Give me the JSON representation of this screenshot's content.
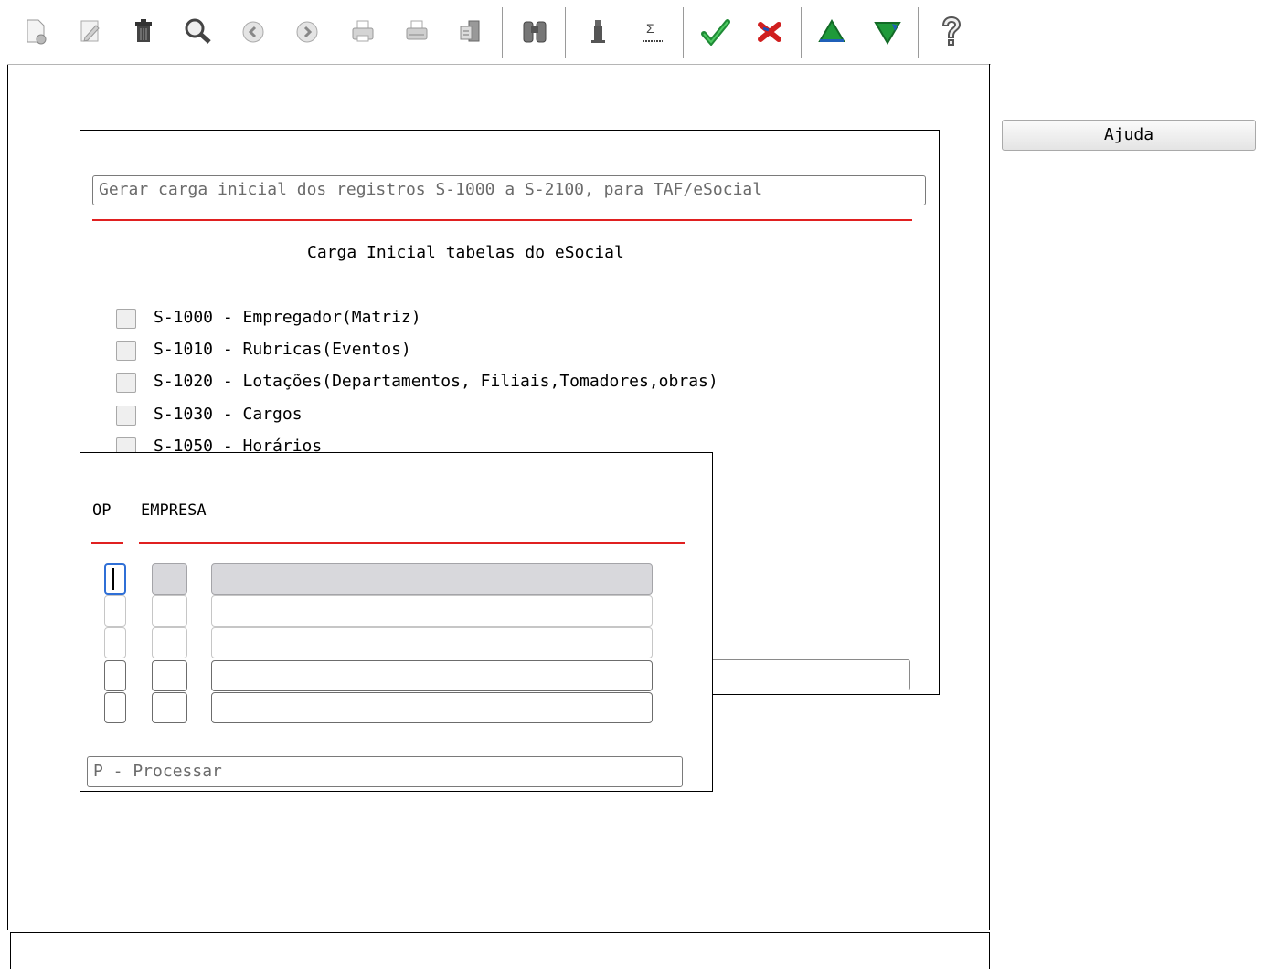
{
  "toolbar": {
    "icons": [
      "new-document-icon",
      "edit-icon",
      "delete-icon",
      "search-icon",
      "previous-icon",
      "next-icon",
      "print-icon",
      "print-setup-icon",
      "export-icon",
      "binoculars-icon",
      "info-icon",
      "sum-icon",
      "confirm-check-icon",
      "cancel-icon",
      "move-up-icon",
      "move-down-icon",
      "help-icon"
    ]
  },
  "side": {
    "help_label": "Ajuda"
  },
  "main_dialog": {
    "description": "Gerar carga inicial dos registros S-1000 a S-2100, para TAF/eSocial",
    "section_title": "Carga Inicial tabelas do eSocial",
    "items": [
      {
        "label": "S-1000 - Empregador(Matriz)",
        "checked": false
      },
      {
        "label": "S-1010 - Rubricas(Eventos)",
        "checked": false
      },
      {
        "label": "S-1020 - Lotações(Departamentos, Filiais,Tomadores,obras)",
        "checked": false
      },
      {
        "label": "S-1030 - Cargos",
        "checked": false
      },
      {
        "label": "S-1050 - Horários",
        "checked": false
      }
    ]
  },
  "company_dialog": {
    "col_op": "OP",
    "col_empresa": "EMPRESA",
    "rows": [
      {
        "op": "",
        "code": "",
        "name": ""
      },
      {
        "op": "",
        "code": "",
        "name": ""
      },
      {
        "op": "",
        "code": "",
        "name": ""
      },
      {
        "op": "",
        "code": "",
        "name": ""
      },
      {
        "op": "",
        "code": "",
        "name": ""
      }
    ],
    "footer_hint": "P - Processar"
  },
  "colors": {
    "accent_red": "#e02020",
    "focus_blue": "#2f6fd6",
    "icon_green": "#1f9a3a"
  }
}
